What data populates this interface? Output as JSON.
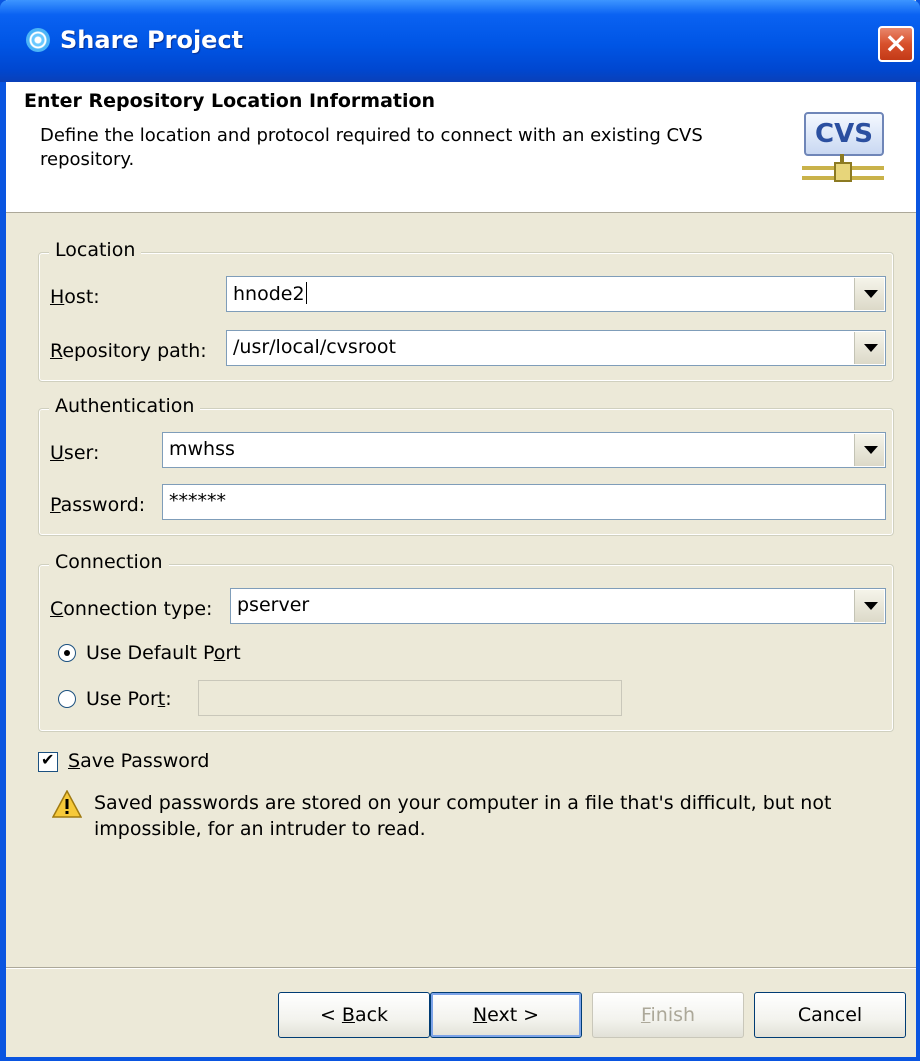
{
  "window": {
    "title": "Share Project"
  },
  "header": {
    "title": "Enter Repository Location Information",
    "description": "Define the location and protocol required to connect with an existing CVS repository.",
    "logo_text": "CVS"
  },
  "location": {
    "group_title": "Location",
    "host_label_mnemonic": "H",
    "host_label_rest": "ost:",
    "host_value": "hnode2",
    "repo_label_mnemonic": "R",
    "repo_label_rest": "epository path:",
    "repo_value": "/usr/local/cvsroot"
  },
  "authentication": {
    "group_title": "Authentication",
    "user_label_mnemonic": "U",
    "user_label_rest": "ser:",
    "user_value": "mwhss",
    "password_label_mnemonic": "P",
    "password_label_rest": "assword:",
    "password_value": "******"
  },
  "connection": {
    "group_title": "Connection",
    "type_label_mnemonic": "C",
    "type_label_rest": "onnection type:",
    "type_value": "pserver",
    "default_port_label_pre": "Use Default P",
    "default_port_label_mnemonic": "o",
    "default_port_label_post": "rt",
    "default_port_selected": true,
    "use_port_label_pre": "Use Por",
    "use_port_label_mnemonic": "t",
    "use_port_label_post": ":",
    "use_port_value": ""
  },
  "save_password": {
    "label_mnemonic": "S",
    "label_rest": "ave Password",
    "checked": true
  },
  "warning": {
    "text": "Saved passwords are stored on your computer in a file that's difficult, but not impossible, for an intruder to read."
  },
  "buttons": {
    "back_pre": "< ",
    "back_mnemonic": "B",
    "back_post": "ack",
    "next_mnemonic": "N",
    "next_post": "ext >",
    "finish_mnemonic": "F",
    "finish_post": "inish",
    "cancel": "Cancel"
  },
  "colors": {
    "titlebar": "#0055E5",
    "dialog_bg": "#ECE9D8",
    "close_button": "#D8502C"
  },
  "icons": {
    "app": "eclipse-icon",
    "close": "close-icon",
    "logo": "cvs-logo-icon",
    "warning": "warning-icon"
  }
}
